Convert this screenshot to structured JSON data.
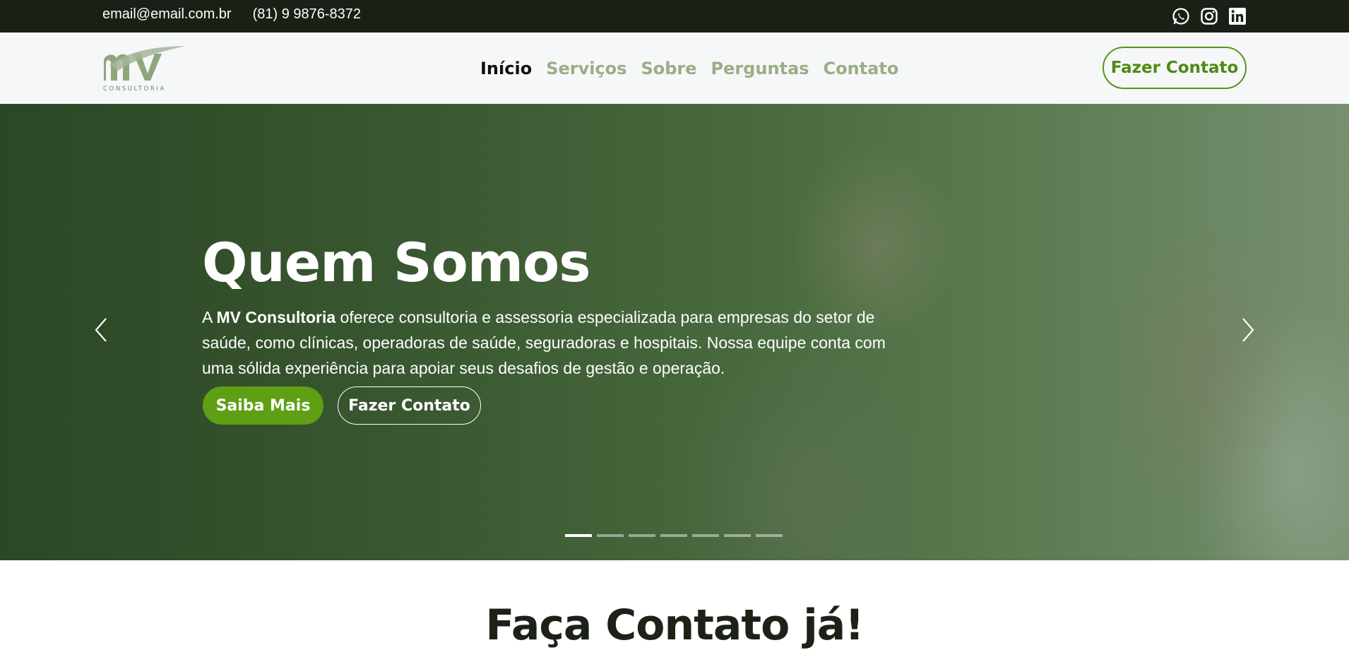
{
  "topbar": {
    "email": "email@email.com.br",
    "phone": "(81) 9 9876-8372",
    "social": [
      "whatsapp-icon",
      "instagram-icon",
      "linkedin-icon"
    ]
  },
  "header": {
    "logo_text": "MV",
    "logo_sub": "CONSULTORIA",
    "nav": [
      {
        "label": "Início",
        "active": true
      },
      {
        "label": "Serviços",
        "active": false
      },
      {
        "label": "Sobre",
        "active": false
      },
      {
        "label": "Perguntas",
        "active": false
      },
      {
        "label": "Contato",
        "active": false
      }
    ],
    "cta_label": "Fazer Contato"
  },
  "hero": {
    "title": "Quem Somos",
    "text_prefix": "A ",
    "text_brand": "MV Consultoria",
    "text_rest": " oferece consultoria e assessoria especializada para empresas do setor de saúde, como clínicas, operadoras de saúde, seguradoras e hospitais. Nossa equipe conta com uma sólida experiência para apoiar seus desafios de gestão e operação.",
    "primary_label": "Saiba Mais",
    "secondary_label": "Fazer Contato",
    "slides_total": 7,
    "slide_active": 1
  },
  "section": {
    "title": "Faça Contato já!"
  },
  "colors": {
    "topbar_bg": "#1b2016",
    "accent_green": "#5e9f14",
    "nav_inactive": "#9aae85"
  }
}
